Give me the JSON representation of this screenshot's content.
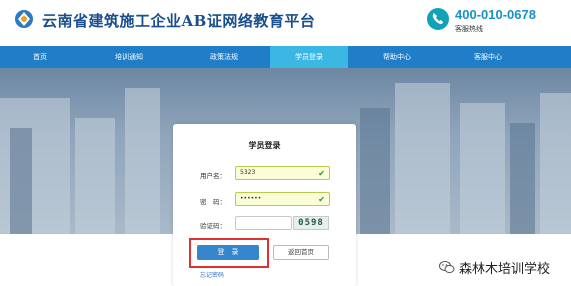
{
  "header": {
    "title": "云南省建筑施工企业AB证网络教育平台",
    "phone": "400-010-0678",
    "phone_label": "客服热线"
  },
  "nav": {
    "items": [
      "首页",
      "培训通知",
      "政策法规",
      "学员登录",
      "帮助中心",
      "客服中心"
    ],
    "active_index": 3
  },
  "login": {
    "title": "学员登录",
    "username_label": "用户名：",
    "username_value": "5323",
    "password_label": "密　码：",
    "password_value": "••••••",
    "captcha_label": "验证码：",
    "captcha_value": "0598",
    "login_button": "登　录",
    "home_button": "返回首页",
    "forgot_link": "忘记密码"
  },
  "watermark": {
    "text": "森林木培训学校"
  },
  "colors": {
    "nav": "#1f7ec7",
    "nav_active": "#3cb6e3",
    "title": "#1a4e8c",
    "phone": "#1593c6",
    "field_bg": "#fbfcd8",
    "login_button": "#3586cc",
    "highlight": "#e0312f"
  }
}
